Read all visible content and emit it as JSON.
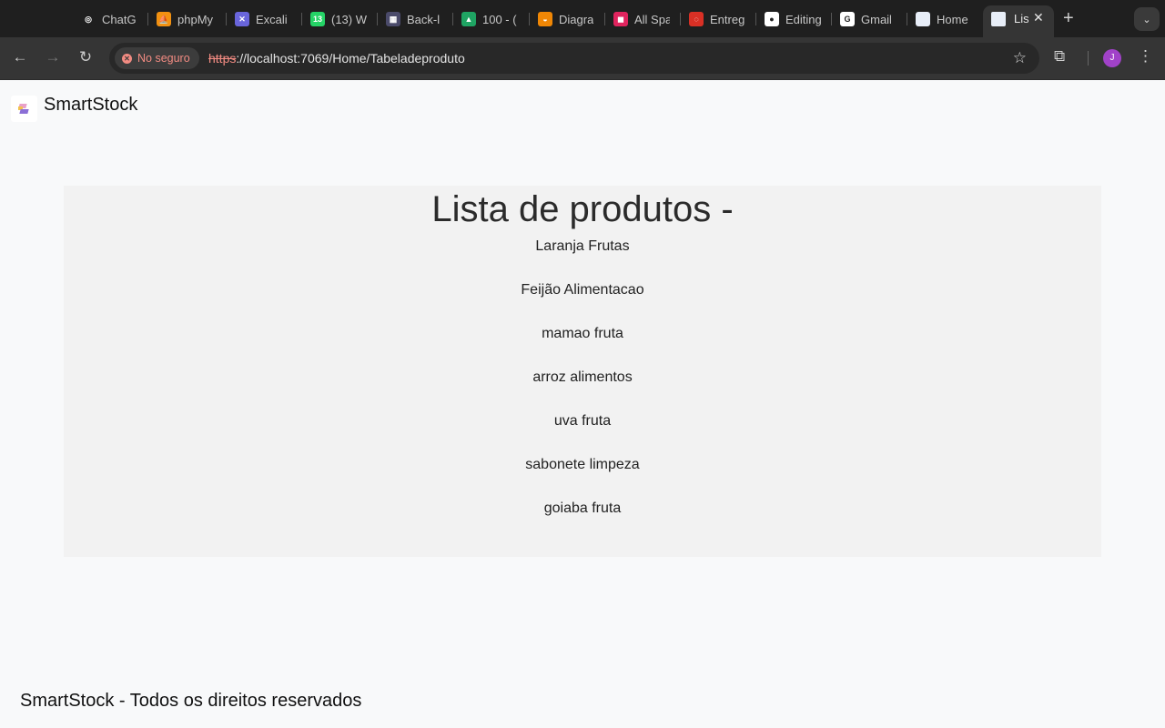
{
  "browser": {
    "tabs": [
      {
        "title": "ChatG",
        "icon": "chatgpt-icon",
        "color": "#1f1f1f",
        "glyph": "◎"
      },
      {
        "title": "phpMy",
        "icon": "phpmyadmin-icon",
        "color": "#f29111",
        "glyph": "⛵"
      },
      {
        "title": "Excali",
        "icon": "excalidraw-icon",
        "color": "#6965db",
        "glyph": "✕"
      },
      {
        "title": "(13) W",
        "icon": "whatsapp-icon",
        "color": "#25d366",
        "glyph": "13"
      },
      {
        "title": "Back-l",
        "icon": "board-icon",
        "color": "#4a4a6a",
        "glyph": "▦"
      },
      {
        "title": "100 - (",
        "icon": "google-drive-icon",
        "color": "#1fa463",
        "glyph": "▲"
      },
      {
        "title": "Diagra",
        "icon": "diagrams-icon",
        "color": "#f08705",
        "glyph": "◒"
      },
      {
        "title": "All Spa",
        "icon": "bookmark-icon",
        "color": "#e0245e",
        "glyph": "◼"
      },
      {
        "title": "Entreg",
        "icon": "loading-ring-icon",
        "color": "#d93025",
        "glyph": "◌"
      },
      {
        "title": "Editing",
        "icon": "github-icon",
        "color": "#ffffff",
        "glyph": "●"
      },
      {
        "title": "Gmail",
        "icon": "google-icon",
        "color": "#ffffff",
        "glyph": "G"
      },
      {
        "title": "Home",
        "icon": "page-icon",
        "color": "#e8eef8",
        "glyph": ""
      }
    ],
    "active_tab": {
      "title": "Lis",
      "icon": "page-icon"
    },
    "new_tab_label": "+",
    "security_label": "No seguro",
    "url_scheme": "https",
    "url_rest": "://localhost:7069/Home/Tabeladeproduto",
    "profile_initial": "J"
  },
  "page": {
    "brand": "SmartStock",
    "title": "Lista de produtos -",
    "products": [
      "Laranja Frutas",
      "Feijão Alimentacao",
      "mamao fruta",
      "arroz alimentos",
      "uva fruta",
      "sabonete limpeza",
      "goiaba fruta"
    ],
    "footer": "SmartStock - Todos os direitos reservados"
  }
}
